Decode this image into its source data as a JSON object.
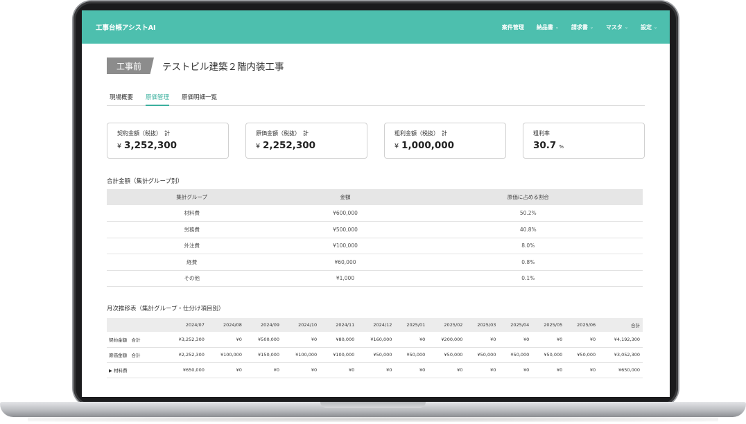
{
  "header": {
    "app_title": "工事台帳アシストAI",
    "nav": [
      {
        "label": "案件管理",
        "has_dropdown": false
      },
      {
        "label": "納品書",
        "has_dropdown": true
      },
      {
        "label": "請求書",
        "has_dropdown": true
      },
      {
        "label": "マスタ",
        "has_dropdown": true
      },
      {
        "label": "設定",
        "has_dropdown": true
      }
    ]
  },
  "project": {
    "status": "工事前",
    "title": "テストビル建築２階内装工事"
  },
  "tabs": [
    {
      "label": "現場概要",
      "active": false
    },
    {
      "label": "原価管理",
      "active": true
    },
    {
      "label": "原価明細一覧",
      "active": false
    }
  ],
  "summary_cards": [
    {
      "label": "契約金額（税抜）　計",
      "currency": "¥",
      "value": "3,252,300",
      "unit": ""
    },
    {
      "label": "原価金額（税抜）　計",
      "currency": "¥",
      "value": "2,252,300",
      "unit": ""
    },
    {
      "label": "粗利金額（税抜）　計",
      "currency": "¥",
      "value": "1,000,000",
      "unit": ""
    },
    {
      "label": "粗利率",
      "currency": "",
      "value": "30.7",
      "unit": "%"
    }
  ],
  "totals_section": {
    "title": "合計金額（集計グループ別）",
    "headers": [
      "集計グループ",
      "金額",
      "原価に占める割合"
    ],
    "rows": [
      [
        "材料費",
        "¥600,000",
        "50.2%"
      ],
      [
        "労務費",
        "¥500,000",
        "40.8%"
      ],
      [
        "外注費",
        "¥100,000",
        "8.0%"
      ],
      [
        "経費",
        "¥60,000",
        "0.8%"
      ],
      [
        "その他",
        "¥1,000",
        "0.1%"
      ]
    ]
  },
  "monthly_section": {
    "title": "月次推移表（集計グループ・仕分け項目別）",
    "headers": [
      "",
      "2024/07",
      "2024/08",
      "2024/09",
      "2024/10",
      "2024/11",
      "2024/12",
      "2025/01",
      "2025/02",
      "2025/03",
      "2025/04",
      "2025/05",
      "2025/06",
      "合計"
    ],
    "rows": [
      [
        "契約金額　合計",
        "¥3,252,300",
        "¥0",
        "¥500,000",
        "¥0",
        "¥80,000",
        "¥160,000",
        "¥0",
        "¥200,000",
        "¥0",
        "¥0",
        "¥0",
        "¥0",
        "¥4,192,300"
      ],
      [
        "原価金額　合計",
        "¥2,252,300",
        "¥100,000",
        "¥150,000",
        "¥100,000",
        "¥100,000",
        "¥50,000",
        "¥50,000",
        "¥50,000",
        "¥50,000",
        "¥50,000",
        "¥50,000",
        "¥50,000",
        "¥3,052,300"
      ],
      [
        "▶ 材料費",
        "¥650,000",
        "¥0",
        "¥0",
        "¥0",
        "¥0",
        "¥0",
        "¥0",
        "¥0",
        "¥0",
        "¥0",
        "¥0",
        "¥0",
        "¥650,000"
      ]
    ]
  },
  "colors": {
    "header_bg": "#4dbfae",
    "accent": "#3bb09e",
    "status_badge": "#8c8c8c"
  }
}
